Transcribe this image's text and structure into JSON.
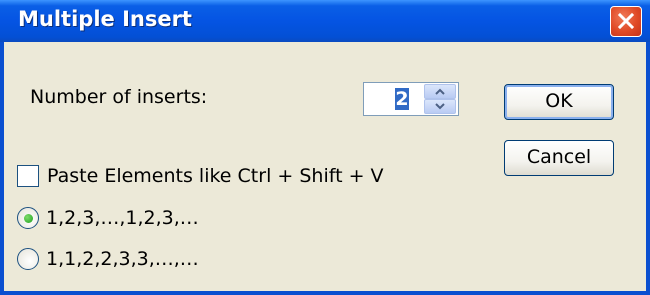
{
  "window": {
    "title": "Multiple Insert",
    "close_label": "Close"
  },
  "inserts": {
    "label": "Number of inserts:",
    "value": "2"
  },
  "buttons": {
    "ok_label": "OK",
    "cancel_label": "Cancel"
  },
  "options": {
    "paste_label": "Paste Elements like Ctrl + Shift + V",
    "paste_checked": false,
    "sequence_label": "1,2,3,…,1,2,3,…",
    "repeat_label": "1,1,2,2,3,3,…,…",
    "selected": "sequence"
  },
  "colors": {
    "titlebar": "#0554e3",
    "close_button": "#e04a26",
    "dialog_background": "#ece9d8",
    "selection": "#316ac5"
  },
  "icons": [
    "close-icon",
    "spin-up-icon",
    "spin-down-icon"
  ]
}
